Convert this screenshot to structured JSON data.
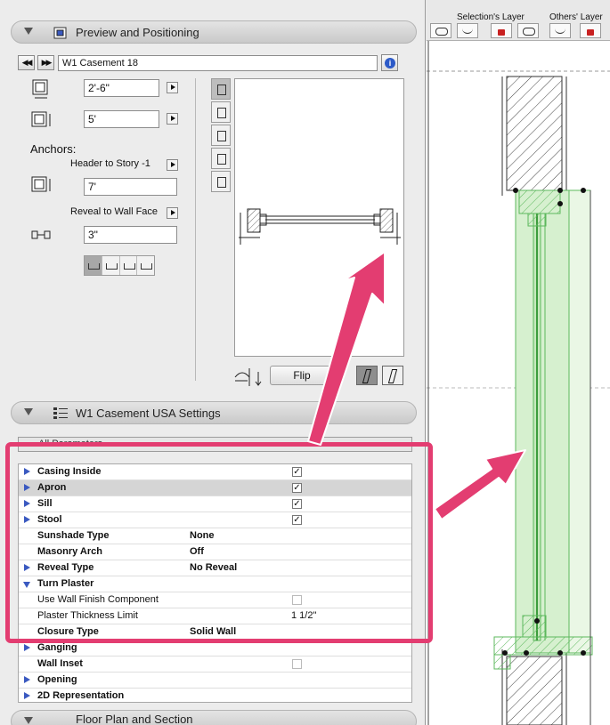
{
  "preview_section": {
    "title": "Preview and Positioning",
    "object_name": "W1 Casement 18",
    "width": "2'-6\"",
    "height": "5'",
    "anchors_label": "Anchors:",
    "header_anchor": "Header to Story -1",
    "header_value": "7'",
    "reveal_anchor": "Reveal to Wall Face",
    "reveal_value": "3\"",
    "flip_label": "Flip"
  },
  "settings_section": {
    "title": "W1 Casement USA Settings",
    "parameter_set": "All Parameters"
  },
  "parameters": [
    {
      "label": "Casing Inside",
      "value": "",
      "bold_label": true,
      "expander": "closed",
      "checkbox": true,
      "shaded": false
    },
    {
      "label": "Apron",
      "value": "",
      "bold_label": true,
      "expander": "closed",
      "checkbox": true,
      "shaded": true
    },
    {
      "label": "Sill",
      "value": "",
      "bold_label": true,
      "expander": "closed",
      "checkbox": true,
      "shaded": false
    },
    {
      "label": "Stool",
      "value": "",
      "bold_label": true,
      "expander": "closed",
      "checkbox": true,
      "shaded": false
    },
    {
      "label": "Sunshade Type",
      "value": "None",
      "bold_label": true,
      "expander": "none",
      "checkbox": null,
      "shaded": false
    },
    {
      "label": "Masonry Arch",
      "value": "Off",
      "bold_label": true,
      "expander": "none",
      "checkbox": null,
      "shaded": false
    },
    {
      "label": "Reveal Type",
      "value": "No Reveal",
      "bold_label": true,
      "expander": "closed",
      "checkbox": null,
      "shaded": false
    },
    {
      "label": "Turn Plaster",
      "value": "",
      "bold_label": true,
      "expander": "open",
      "checkbox": null,
      "shaded": false
    },
    {
      "label": "Use Wall Finish Component",
      "value": "",
      "bold_label": false,
      "expander": "none",
      "checkbox": false,
      "shaded": false
    },
    {
      "label": "Plaster Thickness Limit",
      "value": "1 1/2\"",
      "bold_label": false,
      "expander": "none",
      "checkbox": null,
      "shaded": false,
      "value_col2": true
    },
    {
      "label": "Closure Type",
      "value": "Solid Wall",
      "bold_label": true,
      "expander": "none",
      "checkbox": null,
      "shaded": false
    },
    {
      "label": "Ganging",
      "value": "",
      "bold_label": true,
      "expander": "closed",
      "checkbox": null,
      "shaded": false
    },
    {
      "label": "Wall Inset",
      "value": "",
      "bold_label": true,
      "expander": "none",
      "checkbox": false,
      "shaded": false
    },
    {
      "label": "Opening",
      "value": "",
      "bold_label": true,
      "expander": "closed",
      "checkbox": null,
      "shaded": false
    },
    {
      "label": "2D Representation",
      "value": "",
      "bold_label": true,
      "expander": "closed",
      "checkbox": null,
      "shaded": false
    }
  ],
  "floor_plan_section": {
    "title": "Floor Plan and Section"
  },
  "toolbar": {
    "selection_layer_label": "Selection's Layer",
    "others_layer_label": "Others' Layer"
  },
  "colors": {
    "callout": "#e33d71",
    "window_green": "#5cb85c",
    "window_fill": "#e8f6e3",
    "accent_blue": "#3a59c0"
  }
}
